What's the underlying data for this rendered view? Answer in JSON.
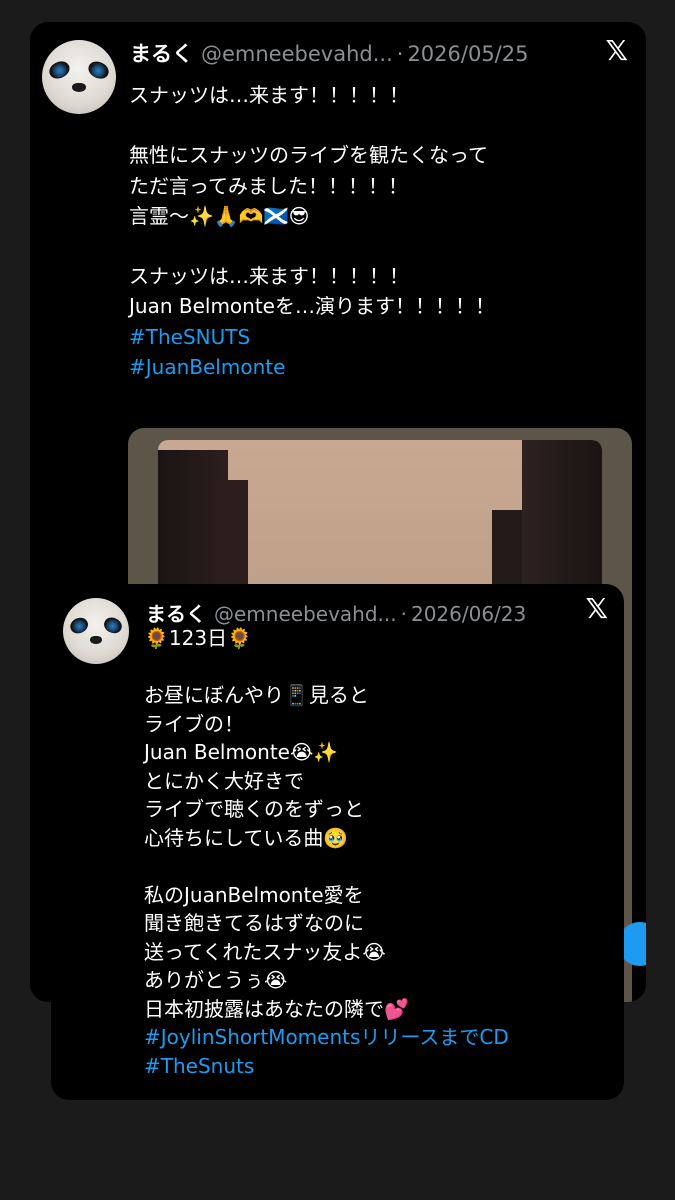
{
  "tweet1": {
    "name": "まるく",
    "handle": "@emneebevahd...",
    "separator": "·",
    "date": "2026/05/25",
    "body": "スナッツは…来ます！！！！！\n\n無性にスナッツのライブを観たくなって\nただ言ってみました！！！！！\n言霊〜✨🙏🫶🏴󠁧󠁢󠁳󠁣󠁴󠁿😎\n\nスナッツは…来ます！！！！！\nJuan Belmonteを…演ります！！！！！\n",
    "hashtags": [
      "#TheSNUTS",
      "#JuanBelmonte"
    ],
    "x_logo": "𝕏"
  },
  "tweet2": {
    "name": "まるく",
    "handle": "@emneebevahd...",
    "separator": "·",
    "date": "2026/06/23",
    "body": "🌻123日🌻\n\nお昼にぼんやり📱見ると\nライブの！\nJuan Belmonte😭✨\nとにかく大好きで\nライブで聴くのをずっと\n心待ちにしている曲🥹\n\n私のJuanBelmonte愛を\n聞き飽きてるはずなのに\n送ってくれたスナッ友よ😭\nありがとうぅ😭\n日本初披露はあなたの隣で💕",
    "hashtags": [
      "#JoylinShortMomentsリリースまでCD",
      "#TheSnuts"
    ],
    "x_logo": "𝕏"
  },
  "colors": {
    "background": "#1b1b1b",
    "card": "#000000",
    "hashtag": "#1d9bf0",
    "muted": "#8b8f94"
  }
}
